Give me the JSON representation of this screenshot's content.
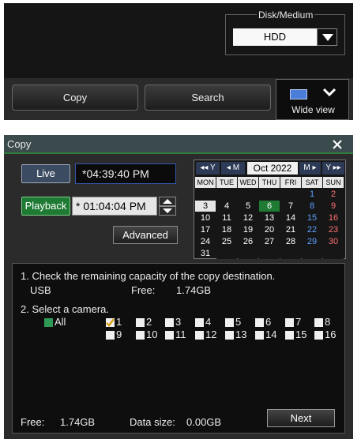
{
  "top_panel": {
    "disk_medium_title": "Disk/Medium",
    "disk_medium_value": "HDD",
    "copy_label": "Copy",
    "search_label": "Search",
    "wide_view_label": "Wide view"
  },
  "dialog": {
    "title": "Copy",
    "live_label": "Live",
    "live_time": "*04:39:40 PM",
    "playback_label": "Playback",
    "playback_time": "* 01:04:04 PM",
    "advanced_label": "Advanced",
    "calendar": {
      "nav_year_prev": "◂◂ Y",
      "nav_month_prev": "◂ M",
      "month": "Oct 2022",
      "nav_month_next": "M ▸",
      "nav_year_next": "Y ▸▸",
      "weekdays": [
        "MON",
        "TUE",
        "WED",
        "THU",
        "FRI",
        "SAT",
        "SUN"
      ],
      "days": [
        [
          "",
          "",
          "",
          "",
          "",
          "1",
          "2"
        ],
        [
          "3",
          "4",
          "5",
          "6",
          "7",
          "8",
          "9"
        ],
        [
          "10",
          "11",
          "12",
          "13",
          "14",
          "15",
          "16"
        ],
        [
          "17",
          "18",
          "19",
          "20",
          "21",
          "22",
          "23"
        ],
        [
          "24",
          "25",
          "26",
          "27",
          "28",
          "29",
          "30"
        ],
        [
          "31",
          "",
          "",
          "",
          "",
          "",
          ""
        ]
      ],
      "highlighted_day": "6",
      "selected_day": "3"
    },
    "step1_text": "1. Check the remaining capacity of the copy destination.",
    "destination": "USB",
    "dest_free_label": "Free:",
    "dest_free_value": "1.74GB",
    "step2_text": "2. Select a camera.",
    "all_label": "All",
    "cameras": [
      {
        "label": "1",
        "checked": true
      },
      {
        "label": "2",
        "checked": false
      },
      {
        "label": "3",
        "checked": false
      },
      {
        "label": "4",
        "checked": false
      },
      {
        "label": "5",
        "checked": false
      },
      {
        "label": "6",
        "checked": false
      },
      {
        "label": "7",
        "checked": false
      },
      {
        "label": "8",
        "checked": false
      },
      {
        "label": "9",
        "checked": false
      },
      {
        "label": "10",
        "checked": false
      },
      {
        "label": "11",
        "checked": false
      },
      {
        "label": "12",
        "checked": false
      },
      {
        "label": "13",
        "checked": false
      },
      {
        "label": "14",
        "checked": false
      },
      {
        "label": "15",
        "checked": false
      },
      {
        "label": "16",
        "checked": false
      }
    ],
    "free_label": "Free:",
    "free_value": "1.74GB",
    "data_size_label": "Data size:",
    "data_size_value": "0.00GB",
    "next_label": "Next"
  },
  "colors": {
    "accent_green": "#1f7a34",
    "checkbox_green": "#2f9a55",
    "live_blue": "#3b4b62"
  }
}
